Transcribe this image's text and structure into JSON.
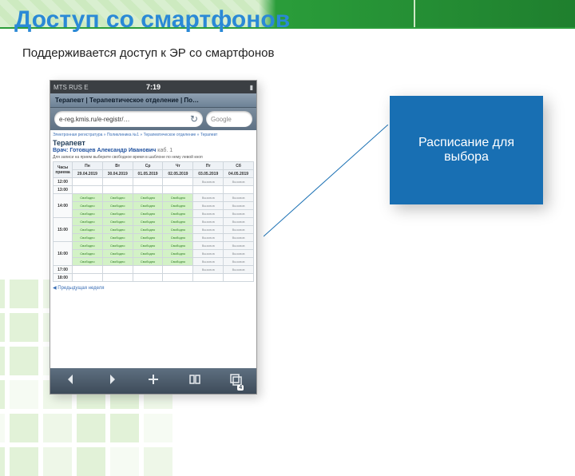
{
  "slide": {
    "title": "Доступ со смартфонов",
    "subtitle": "Поддерживается доступ к ЭР со смартфонов"
  },
  "callout": {
    "text": "Расписание для выбора"
  },
  "phone": {
    "status": {
      "carrier": "MTS RUS  E",
      "time": "7:19"
    },
    "tab_title": "Терапевт | Терапевтическое отделение | По…",
    "url": "e-reg.kmis.ru/e-registr/…",
    "search_placeholder": "Google",
    "toolbar_tab_count": "4"
  },
  "schedule": {
    "breadcrumb": "Электронная регистратура » Поликлиника №1 » Терапевтическое отделение » Терапевт",
    "specialty": "Терапевт",
    "doctor_prefix": "Врач:",
    "doctor": "Готовцев Александр Иванович",
    "doctor_room": "каб. 1",
    "hint": "Для записи на прием выберите свободное время в шаблоне по нему левой кноп",
    "time_header": "Часы приема",
    "days": [
      {
        "dow": "Пн",
        "date": "29.04.2019"
      },
      {
        "dow": "Вт",
        "date": "30.04.2019"
      },
      {
        "dow": "Ср",
        "date": "01.05.2019"
      },
      {
        "dow": "Чт",
        "date": "02.05.2019"
      },
      {
        "dow": "Пт",
        "date": "03.05.2019"
      },
      {
        "dow": "Сб",
        "date": "04.05.2019"
      }
    ],
    "hours": [
      "12:00",
      "13:00",
      "14:00",
      "15:00",
      "16:00",
      "17:00",
      "18:00"
    ],
    "slot_free_label": "Свободно",
    "slot_blocked_label": "Вызовов",
    "prev_week": "◀ Предыдущая неделя"
  }
}
